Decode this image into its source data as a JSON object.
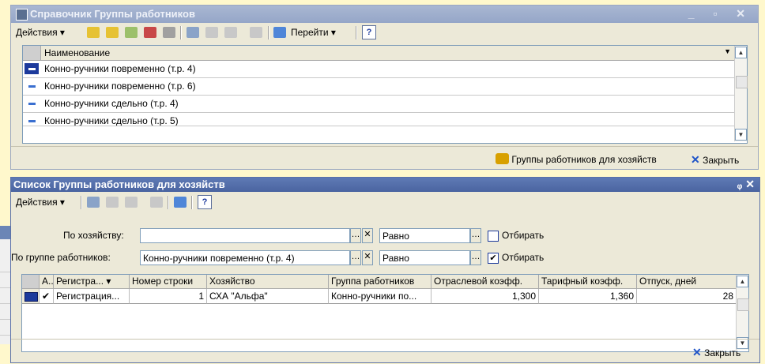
{
  "win1": {
    "title": "Справочник Группы работников",
    "window_buttons": "_ ▫ ✕",
    "toolbar": {
      "actions": "Действия",
      "goto": "Перейти",
      "help": "?"
    },
    "list": {
      "header": "Наименование",
      "rows": [
        "Конно-ручники повременно (т.р. 4)",
        "Конно-ручники повременно (т.р. 6)",
        "Конно-ручники сдельно (т.р. 4)",
        "Конно-ручники сдельно (т.р. 5)"
      ]
    },
    "footer": {
      "groups": "Группы работников для хозяйств",
      "close": "Закрыть"
    }
  },
  "win2": {
    "title": "Список Группы работников для хозяйств",
    "title_buttons": "ᵩ ✕",
    "toolbar": {
      "actions": "Действия",
      "help": "?"
    },
    "filters": [
      {
        "label": "По хозяйству:",
        "value": "",
        "cond": "Равно",
        "apply_label": "Отбирать",
        "checked": false
      },
      {
        "label": "По группе работников:",
        "value": "Конно-ручники повременно (т.р. 4)",
        "cond": "Равно",
        "apply_label": "Отбирать",
        "checked": true
      }
    ],
    "table": {
      "headers": [
        "А...",
        "Регистра...",
        "Номер строки",
        "Хозяйство",
        "Группа работников",
        "Отраслевой коэфф.",
        "Тарифный коэфф.",
        "Отпуск, дней"
      ],
      "rows": [
        {
          "check": "✔",
          "reg": "Регистрация...",
          "line": "1",
          "farm": "СХА \"Альфа\"",
          "group": "Конно-ручники по...",
          "branch": "1,300",
          "tariff": "1,360",
          "leave": "28"
        }
      ]
    },
    "footer": {
      "close": "Закрыть"
    }
  }
}
